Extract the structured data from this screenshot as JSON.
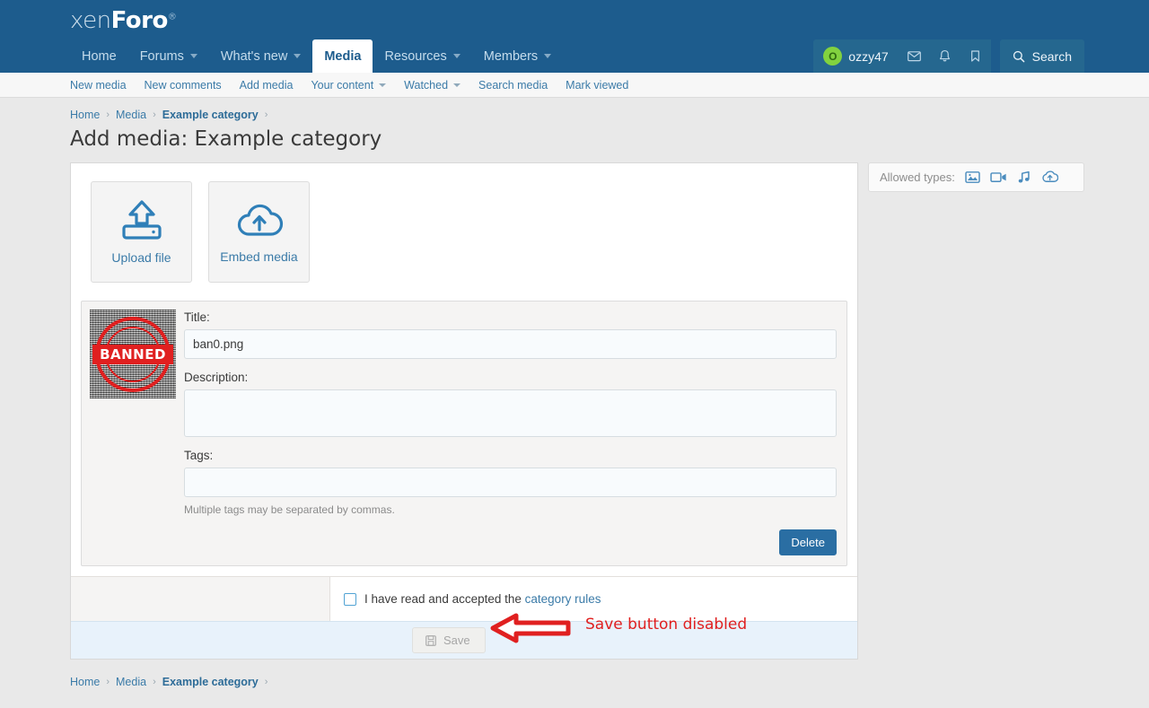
{
  "site": {
    "logo_thin": "xen",
    "logo_bold": "Foro",
    "logo_mark": "®"
  },
  "nav": {
    "items": [
      {
        "label": "Home",
        "caret": false,
        "active": false
      },
      {
        "label": "Forums",
        "caret": true,
        "active": false
      },
      {
        "label": "What's new",
        "caret": true,
        "active": false
      },
      {
        "label": "Media",
        "caret": false,
        "active": true
      },
      {
        "label": "Resources",
        "caret": true,
        "active": false
      },
      {
        "label": "Members",
        "caret": true,
        "active": false
      }
    ]
  },
  "user": {
    "name": "ozzy47",
    "avatar_letter": "O",
    "avatar_color": "#82d23f",
    "inbox_icon": "envelope-icon",
    "alerts_icon": "bell-icon",
    "bookmarks_icon": "bookmark-icon",
    "search_label": "Search",
    "search_icon": "search-icon"
  },
  "subnav": {
    "items": [
      {
        "label": "New media",
        "caret": false
      },
      {
        "label": "New comments",
        "caret": false
      },
      {
        "label": "Add media",
        "caret": false
      },
      {
        "label": "Your content",
        "caret": true
      },
      {
        "label": "Watched",
        "caret": true
      },
      {
        "label": "Search media",
        "caret": false
      },
      {
        "label": "Mark viewed",
        "caret": false
      }
    ]
  },
  "breadcrumb": {
    "items": [
      {
        "label": "Home",
        "current": false
      },
      {
        "label": "Media",
        "current": false
      },
      {
        "label": "Example category",
        "current": true
      }
    ],
    "separator": "›"
  },
  "page": {
    "title": "Add media: Example category"
  },
  "upload": {
    "choices": [
      {
        "label": "Upload file",
        "icon": "hard-drive-upload-icon"
      },
      {
        "label": "Embed media",
        "icon": "cloud-upload-icon"
      }
    ]
  },
  "allowed_types": {
    "label": "Allowed types:",
    "icons": [
      "image-icon",
      "video-icon",
      "audio-icon",
      "cloud-icon"
    ]
  },
  "item": {
    "thumbnail_alt": "BANNED stamp image",
    "stamp_text": "BANNED",
    "title_label": "Title:",
    "title_value": "ban0.png",
    "title_placeholder": "",
    "description_label": "Description:",
    "description_value": "",
    "description_placeholder": "",
    "tags_label": "Tags:",
    "tags_value": "",
    "tags_placeholder": "",
    "tags_hint": "Multiple tags may be separated by commas.",
    "delete_label": "Delete"
  },
  "terms": {
    "checked": false,
    "text_before": "I have read and accepted the",
    "link_label": "category rules"
  },
  "save": {
    "label": "Save",
    "icon": "floppy-save-icon",
    "disabled": true
  },
  "annotation": {
    "text": "Save button disabled",
    "color": "#e02020",
    "arrow": "left-arrow-annotation"
  },
  "colors": {
    "header_blue": "#1d5c8d",
    "link_blue": "#3b7ba8",
    "accent_blue": "#2a6ea3",
    "page_bg": "#e9e9e9",
    "save_bar": "#e8f2fb",
    "annotation_red": "#e02020"
  }
}
